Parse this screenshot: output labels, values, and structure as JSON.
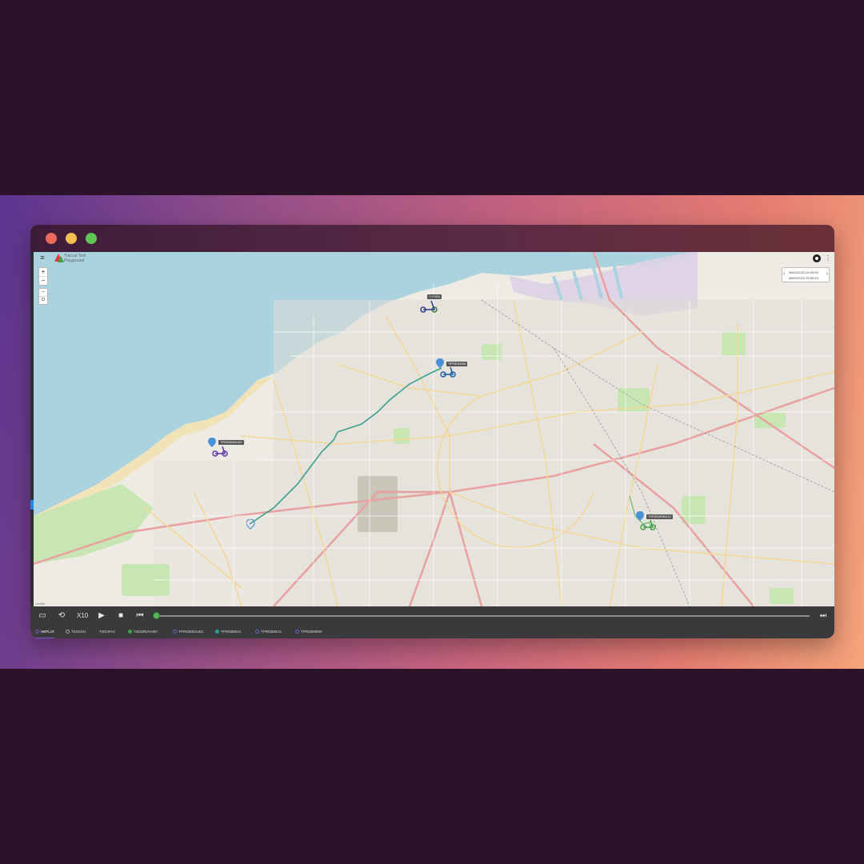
{
  "app": {
    "logo_text": "Traccar Tool Playground",
    "menu_icon": "hamburger-icon",
    "github_icon": "github-icon",
    "more_icon": "kebab-menu-icon"
  },
  "map": {
    "zoom_in": "+",
    "zoom_out": "−",
    "ctrl_a": "⇔",
    "ctrl_b": "⊙",
    "attribution": "Leaflet",
    "date_range": {
      "start": "06/02/2022 00:00:00",
      "end": "06/02/2022 23:59:59"
    },
    "device_labels": [
      "T-YS2A",
      "TPR3DM0M",
      "TPR03M04U52",
      "TPR3DM0RA12"
    ]
  },
  "controls": {
    "speed_label": "X10",
    "icons": [
      "screen-icon",
      "replay-icon",
      "play-icon",
      "stop-icon",
      "skip-start-icon",
      "skip-end-icon"
    ],
    "progress": 0.0
  },
  "tabs": [
    {
      "label": "HEPLAT",
      "active": true,
      "color": "#7e57c2"
    },
    {
      "label": "T04D401",
      "active": false,
      "color": "#9e9e9e"
    },
    {
      "label": "T4DHFA4",
      "active": false,
      "color": "#9e9e9e"
    },
    {
      "label": "T4DDRIAH487",
      "active": false,
      "color": "#43a047"
    },
    {
      "label": "TPR03M04U52",
      "active": false,
      "color": "#5c6bc0"
    },
    {
      "label": "TPR03M041",
      "active": false,
      "color": "#26a69a"
    },
    {
      "label": "TPR03M0A1",
      "active": false,
      "color": "#5c6bc0"
    },
    {
      "label": "TPR03M0M0",
      "active": false,
      "color": "#5c6bc0"
    }
  ],
  "colors": {
    "background": "#2d1329",
    "sea": "#aad3df",
    "land": "#eeebe5",
    "route": "#3aa08f",
    "marker_blue": "#4a90d9",
    "marker_purple": "#5e35b1",
    "marker_green": "#43a047",
    "control_bar": "#3a3a3d"
  }
}
